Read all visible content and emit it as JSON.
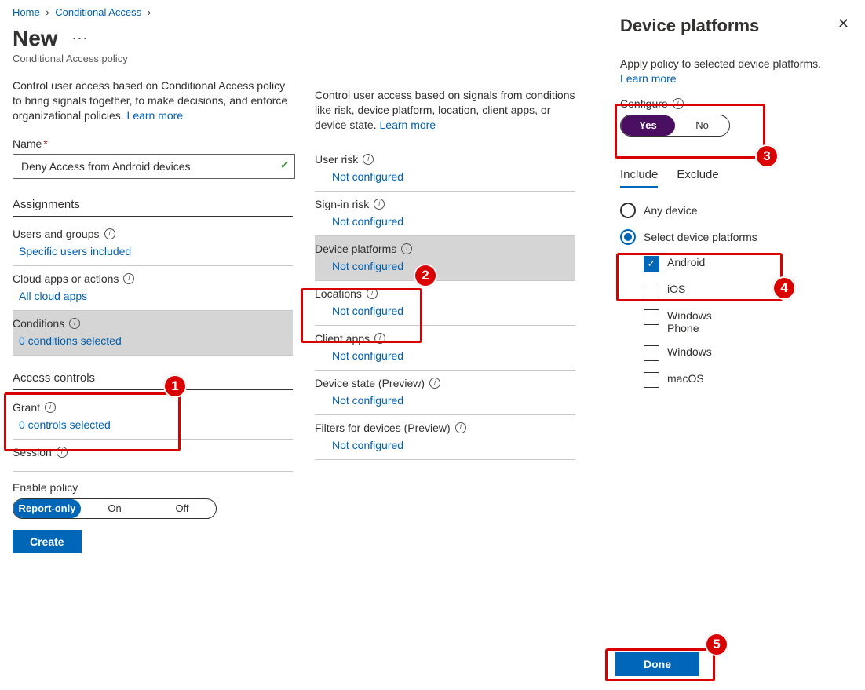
{
  "breadcrumb": {
    "home": "Home",
    "mid": "Conditional Access"
  },
  "header": {
    "title": "New",
    "subtitle": "Conditional Access policy"
  },
  "intro1": {
    "text": "Control user access based on Conditional Access policy to bring signals together, to make decisions, and enforce organizational policies. ",
    "learn": "Learn more"
  },
  "name": {
    "label": "Name",
    "value": "Deny Access from Android devices"
  },
  "sections": {
    "assignments": "Assignments",
    "access_controls": "Access controls"
  },
  "rows1": {
    "users": {
      "title": "Users and groups",
      "value": "Specific users included"
    },
    "cloud": {
      "title": "Cloud apps or actions",
      "value": "All cloud apps"
    },
    "conditions": {
      "title": "Conditions",
      "value": "0 conditions selected"
    },
    "grant": {
      "title": "Grant",
      "value": "0 controls selected"
    },
    "session": {
      "title": "Session"
    }
  },
  "enable": {
    "label": "Enable policy",
    "opts": {
      "report": "Report-only",
      "on": "On",
      "off": "Off"
    }
  },
  "create_label": "Create",
  "intro2": {
    "text": "Control user access based on signals from conditions like risk, device platform, location, client apps, or device state. ",
    "learn": "Learn more"
  },
  "rows2": {
    "user_risk": {
      "title": "User risk",
      "value": "Not configured"
    },
    "signin_risk": {
      "title": "Sign-in risk",
      "value": "Not configured"
    },
    "device_platforms": {
      "title": "Device platforms",
      "value": "Not configured"
    },
    "locations": {
      "title": "Locations",
      "value": "Not configured"
    },
    "client_apps": {
      "title": "Client apps",
      "value": "Not configured"
    },
    "device_state": {
      "title": "Device state (Preview)",
      "value": "Not configured"
    },
    "filters": {
      "title": "Filters for devices (Preview)",
      "value": "Not configured"
    }
  },
  "panel": {
    "title": "Device platforms",
    "intro": "Apply policy to selected device platforms.",
    "learn": "Learn more",
    "configure_label": "Configure",
    "yes": "Yes",
    "no": "No",
    "tabs": {
      "include": "Include",
      "exclude": "Exclude"
    },
    "radio": {
      "any": "Any device",
      "select": "Select device platforms"
    },
    "platforms": {
      "android": "Android",
      "ios": "iOS",
      "winphone": "Windows Phone",
      "windows": "Windows",
      "macos": "macOS"
    },
    "done": "Done"
  }
}
